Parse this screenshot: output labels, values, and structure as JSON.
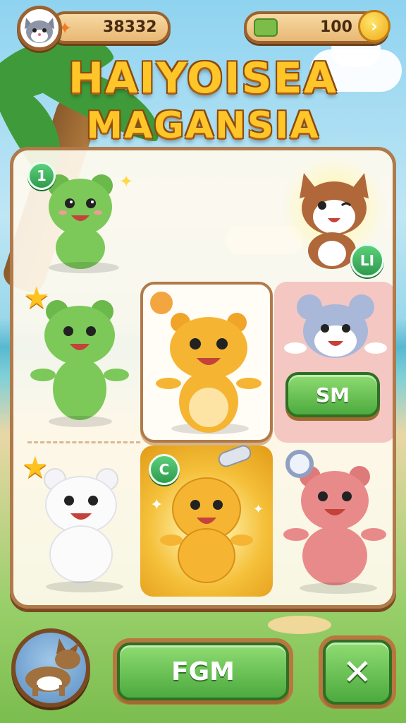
{
  "hud": {
    "score": "38332",
    "coins": "100",
    "avatar_icon": "cat-face-icon",
    "fish_icon": "fish-icon",
    "cash_icon": "cash-icon",
    "coin_icon": "gold-coin-icon"
  },
  "title": {
    "line1": "HAIYOISEA",
    "line2": "MAGANSIA"
  },
  "grid": {
    "cells": [
      {
        "name": "green-bear-1",
        "badge": "1",
        "body": "#7cc95a",
        "ear": "#6bb84b"
      },
      {
        "name": "calico-cat",
        "badge": "LI",
        "body": "#b0683a"
      },
      {
        "name": "green-bear-2",
        "body": "#7cc95a",
        "ear": "#6bb84b"
      },
      {
        "name": "yellow-hamster-selected",
        "body": "#f5b532"
      },
      {
        "name": "blue-grey-mouse",
        "body": "#a9b7d8",
        "button": "SM"
      },
      {
        "name": "white-bear",
        "body": "#fbfbfb"
      },
      {
        "name": "yellow-hamster-glow",
        "badge": "C",
        "body": "#f5b532"
      },
      {
        "name": "pink-bear",
        "body": "#e98a8a"
      }
    ]
  },
  "bottom": {
    "primary_label": "FGM",
    "close_icon": "close-x-icon",
    "portrait_icon": "dog-portrait-icon"
  },
  "colors": {
    "accent_green": "#4caa3e",
    "frame_brown": "#b07a4a",
    "title_gold": "#ffc62a"
  }
}
